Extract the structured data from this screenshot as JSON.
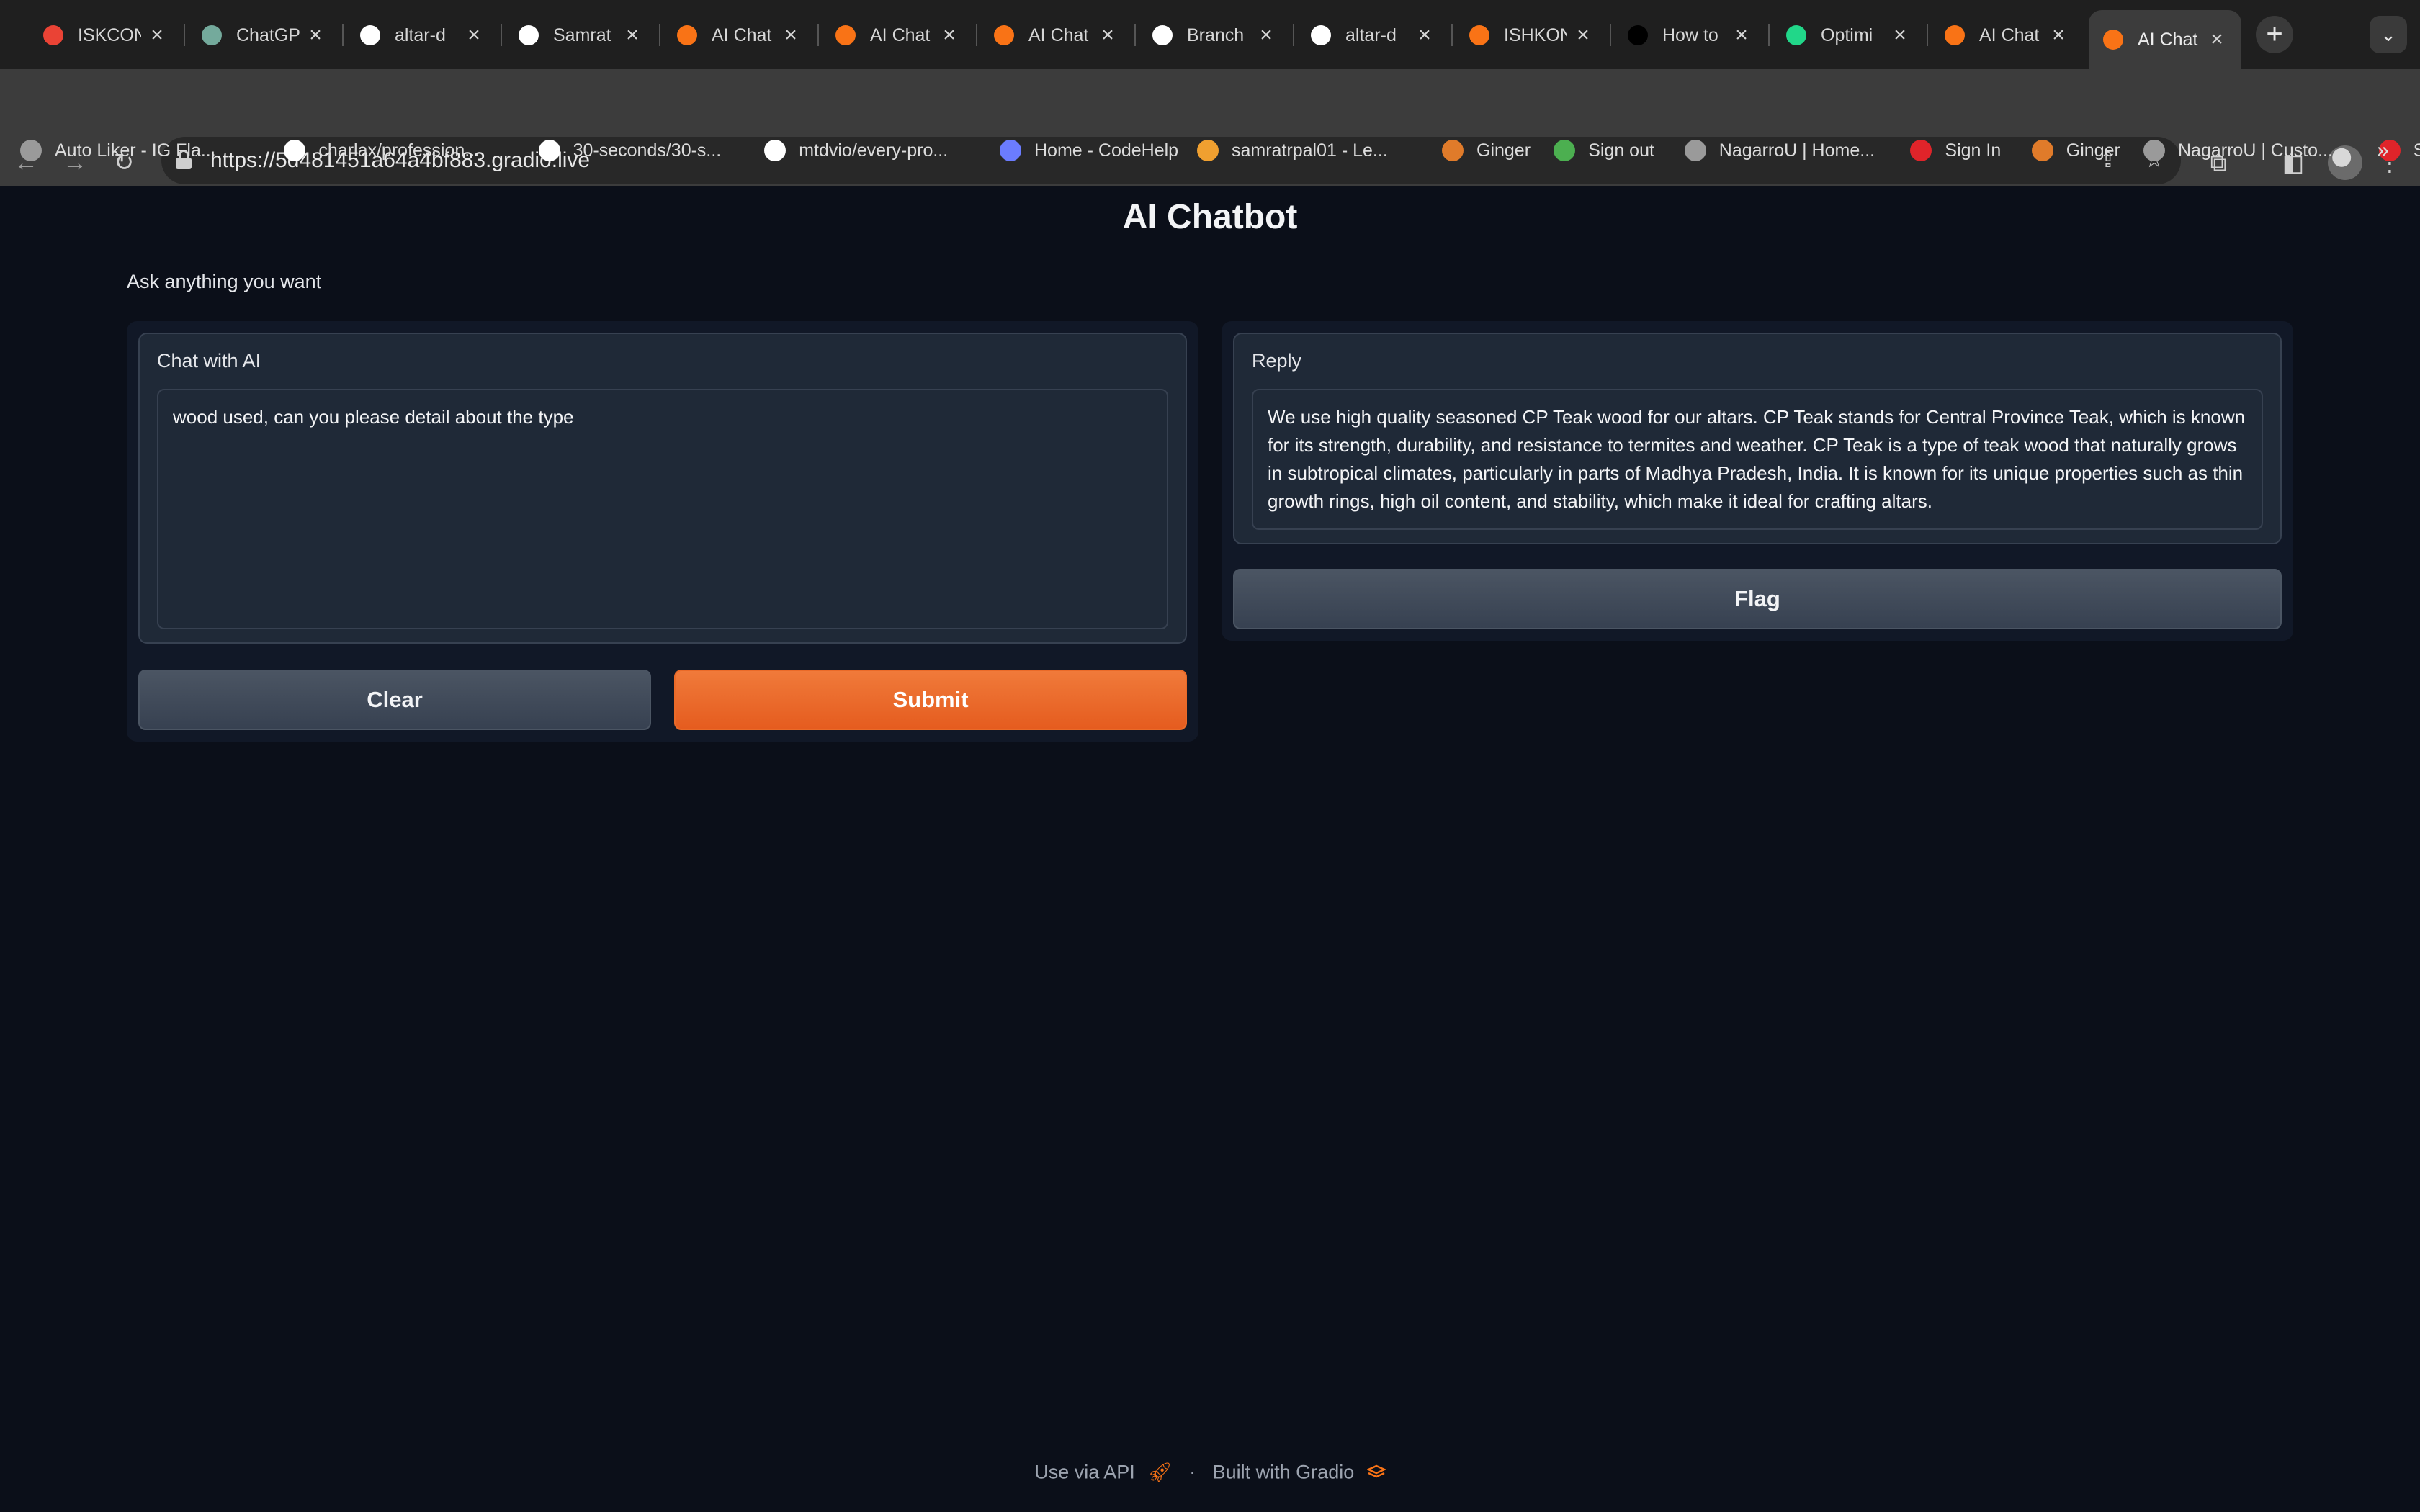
{
  "browser": {
    "tabs": [
      {
        "title": "ISKCON",
        "favicon": "maps-pin-icon",
        "color": "#ea4335"
      },
      {
        "title": "ChatGPT",
        "favicon": "openai-icon",
        "color": "#74aa9c"
      },
      {
        "title": "altar-d",
        "favicon": "github-icon",
        "color": "#ffffff"
      },
      {
        "title": "Samrat",
        "favicon": "github-icon",
        "color": "#ffffff"
      },
      {
        "title": "AI Chat",
        "favicon": "gradio-icon",
        "color": "#f97316"
      },
      {
        "title": "AI Chat",
        "favicon": "gradio-icon",
        "color": "#f97316"
      },
      {
        "title": "AI Chat",
        "favicon": "gradio-icon",
        "color": "#f97316"
      },
      {
        "title": "Branch",
        "favicon": "github-icon",
        "color": "#ffffff"
      },
      {
        "title": "altar-d",
        "favicon": "github-icon",
        "color": "#ffffff"
      },
      {
        "title": "ISHKON",
        "favicon": "gradio-icon",
        "color": "#f97316"
      },
      {
        "title": "How to",
        "favicon": "bb-icon",
        "color": "#000000"
      },
      {
        "title": "Optimi",
        "favicon": "pycharm-icon",
        "color": "#21d789"
      },
      {
        "title": "AI Chat",
        "favicon": "gradio-icon",
        "color": "#f97316"
      },
      {
        "title": "AI Chat",
        "favicon": "gradio-icon",
        "color": "#f97316"
      }
    ],
    "url": "https://5d481451a64a4bf883.gradio.live",
    "bookmarks": [
      {
        "label": "Auto Liker - IG Fla...",
        "icon": "globe-icon"
      },
      {
        "label": "charlax/profession...",
        "icon": "github-icon"
      },
      {
        "label": "30-seconds/30-s...",
        "icon": "github-icon"
      },
      {
        "label": "mtdvio/every-pro...",
        "icon": "github-icon"
      },
      {
        "label": "Home - CodeHelp",
        "icon": "codehelp-icon"
      },
      {
        "label": "samratrpal01 - Le...",
        "icon": "leetcode-icon"
      },
      {
        "label": "Ginger",
        "icon": "ginger-icon"
      },
      {
        "label": "Sign out",
        "icon": "microsoft-icon"
      },
      {
        "label": "NagarroU | Home...",
        "icon": "globe-icon"
      },
      {
        "label": "Sign In",
        "icon": "oracle-icon"
      },
      {
        "label": "Ginger",
        "icon": "ginger-icon"
      },
      {
        "label": "NagarroU | Custo...",
        "icon": "globe-icon"
      },
      {
        "label": "Sign In",
        "icon": "oracle-icon"
      }
    ],
    "bookmarks_overflow": "»"
  },
  "app": {
    "title": "AI Chatbot",
    "description": "Ask anything you want",
    "input": {
      "label": "Chat with AI",
      "value": "wood used, can you please detail about the type"
    },
    "output": {
      "label": "Reply",
      "value": "We use high quality seasoned CP Teak wood for our altars. CP Teak stands for Central Province Teak, which is known for its strength, durability, and resistance to termites and weather. CP Teak is a type of teak wood that naturally grows in subtropical climates, particularly in parts of Madhya Pradesh, India. It is known for its unique properties such as thin growth rings, high oil content, and stability, which make it ideal for crafting altars."
    },
    "buttons": {
      "clear": "Clear",
      "submit": "Submit",
      "flag": "Flag"
    },
    "footer": {
      "api": "Use via API",
      "separator": "·",
      "built": "Built with Gradio"
    },
    "colors": {
      "background": "#0b0f19",
      "accent": "#ea6a28"
    }
  }
}
